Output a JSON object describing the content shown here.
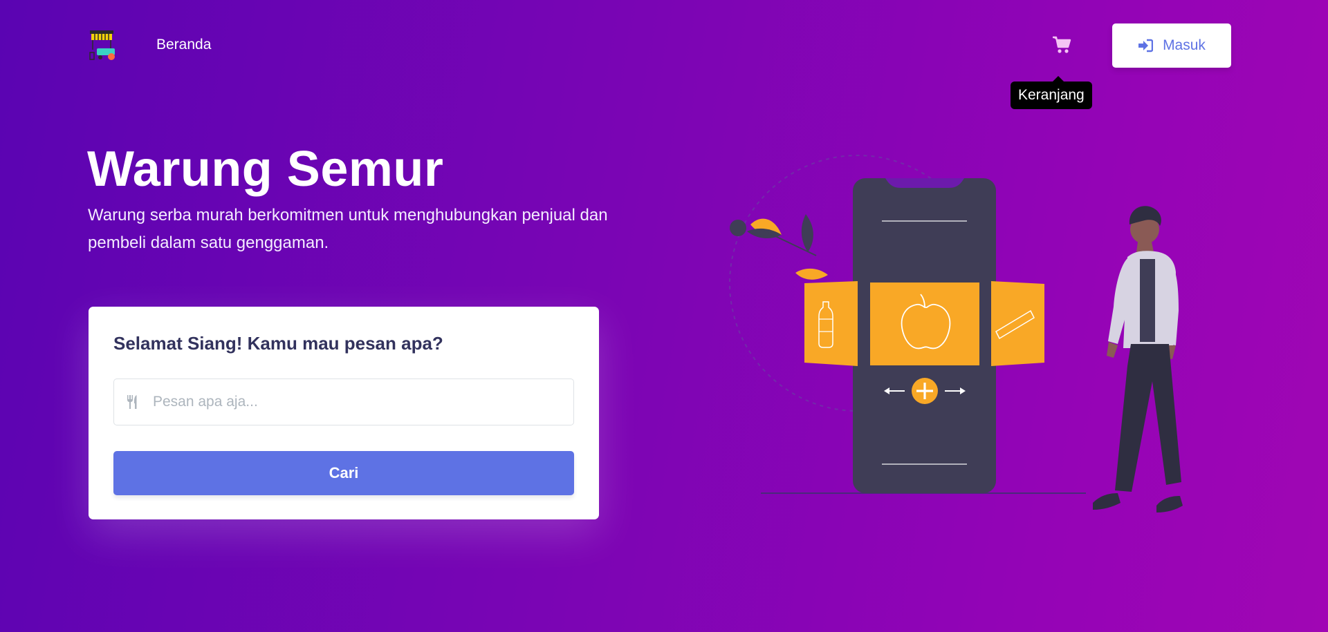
{
  "nav": {
    "logo_icon": "food-cart-icon",
    "home_label": "Beranda",
    "cart_icon": "shopping-cart-icon",
    "cart_tooltip": "Keranjang",
    "login_icon": "sign-in-icon",
    "login_label": "Masuk"
  },
  "hero": {
    "title": "Warung Semur",
    "subtitle": "Warung serba murah berkomitmen untuk menghubungkan penjual dan pembeli dalam satu genggaman."
  },
  "search_card": {
    "greeting": "Selamat Siang! Kamu mau pesan apa?",
    "input_icon": "utensils-icon",
    "input_placeholder": "Pesan apa aja...",
    "input_value": "",
    "button_label": "Cari"
  },
  "colors": {
    "primary": "#5e72e4",
    "accent_orange": "#f9a826",
    "phone_dark": "#3f3d56"
  }
}
